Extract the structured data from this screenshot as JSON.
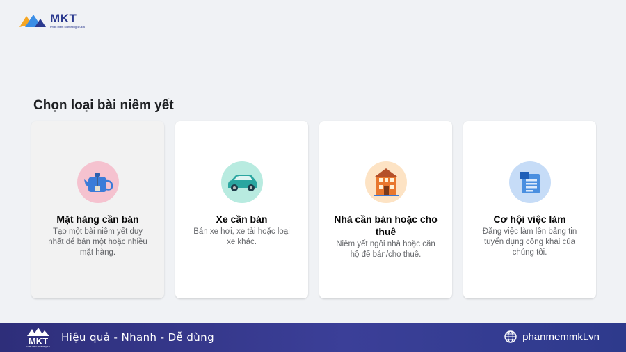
{
  "logo": {
    "brand": "MKT",
    "tagline": "Phần mềm Marketing 4.0kia"
  },
  "heading": "Chọn loại bài niêm yết",
  "cards": [
    {
      "title": "Mặt hàng cần bán",
      "desc": "Tạo một bài niêm yết duy nhất để bán một hoặc nhiều mặt hàng.",
      "icon": "teapot-icon"
    },
    {
      "title": "Xe cần bán",
      "desc": "Bán xe hơi, xe tải hoặc loại xe khác.",
      "icon": "car-icon"
    },
    {
      "title": "Nhà cần bán hoặc cho thuê",
      "desc": "Niêm yết ngôi nhà hoặc căn hộ để bán/cho thuê.",
      "icon": "house-icon"
    },
    {
      "title": "Cơ hội việc làm",
      "desc": "Đăng việc làm lên bảng tin tuyển dụng công khai của chúng tôi.",
      "icon": "job-board-icon"
    }
  ],
  "footer": {
    "brand": "MKT",
    "tagline": "Phần mềm Marketing 4.0",
    "slogan": "Hiệu quả - Nhanh - Dễ dùng",
    "website": "phanmemmkt.vn"
  },
  "colors": {
    "background": "#f0f2f5",
    "footer": "#3b3f98",
    "card_selected": "#f2f2f2"
  }
}
